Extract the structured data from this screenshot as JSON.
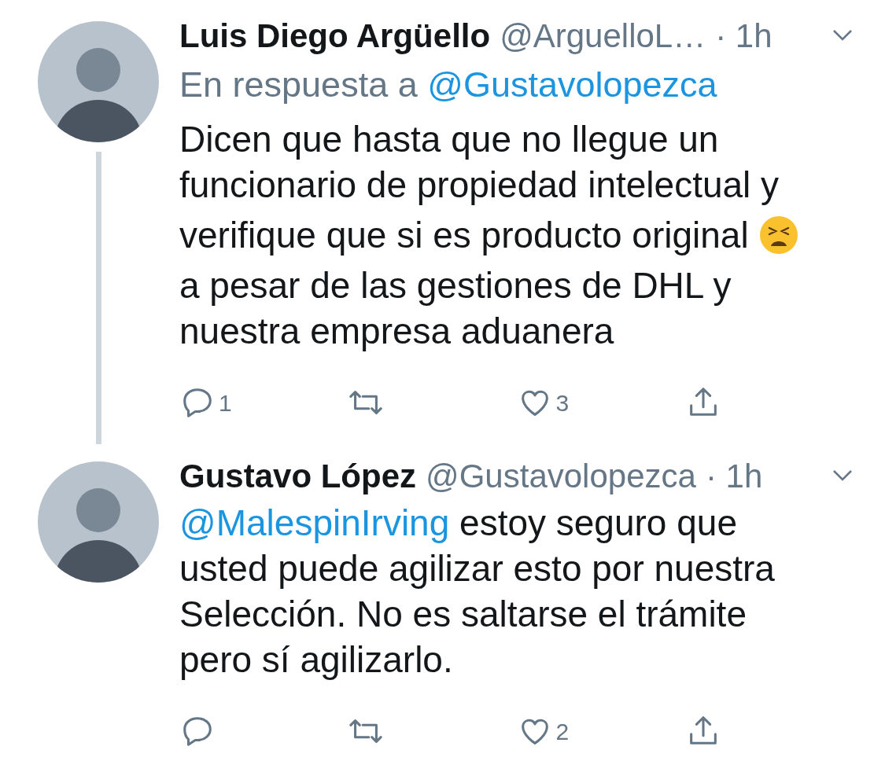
{
  "tweets": [
    {
      "name": "Luis Diego Argüello",
      "handle": "@ArguelloL…",
      "time": "· 1h",
      "thread_line": true,
      "reply_to": {
        "prefix": "En respuesta a",
        "handle": "@Gustavolopezca"
      },
      "lines": [
        {
          "kind": "plain",
          "text": "Dicen que hasta que no llegue un"
        },
        {
          "kind": "plain",
          "text": "funcionario de propiedad intelectual y"
        },
        {
          "kind": "emoji_end",
          "text": "verifique que si es producto original"
        },
        {
          "kind": "plain",
          "text": "a pesar de las gestiones de DHL y"
        },
        {
          "kind": "plain",
          "text": "nuestra empresa aduanera"
        }
      ],
      "actions": [
        {
          "kind": "reply",
          "count": "1"
        },
        {
          "kind": "retweet"
        },
        {
          "kind": "like",
          "count": "3"
        },
        {
          "kind": "share"
        }
      ]
    },
    {
      "name": "Gustavo López",
      "handle": "@Gustavolopezca",
      "time": "· 1h",
      "thread_line": false,
      "mention": "@MalespinIrving",
      "lines": [
        {
          "kind": "plain",
          "text": "estoy seguro que"
        },
        {
          "kind": "plain",
          "text": "usted puede agilizar esto por nuestra"
        },
        {
          "kind": "plain",
          "text": "Selección. No es saltarse el trámite"
        },
        {
          "kind": "plain",
          "text": "pero sí agilizarlo."
        }
      ],
      "actions": [
        {
          "kind": "reply"
        },
        {
          "kind": "retweet"
        },
        {
          "kind": "like",
          "count": "2"
        },
        {
          "kind": "share"
        }
      ]
    }
  ]
}
